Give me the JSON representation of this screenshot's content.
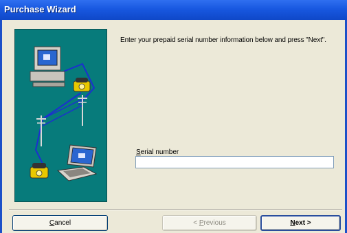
{
  "window": {
    "title": "Purchase Wizard"
  },
  "instruction": "Enter your prepaid serial number information below and press \"Next\".",
  "serial": {
    "label_accel": "S",
    "label_rest": "erial number",
    "value": ""
  },
  "buttons": {
    "cancel": {
      "accel": "C",
      "rest": "ancel"
    },
    "previous": {
      "prefix": "< ",
      "accel": "P",
      "rest": "revious"
    },
    "next": {
      "accel": "N",
      "rest": "ext >"
    }
  },
  "colors": {
    "title_bar": "#1858e0",
    "panel_bg": "#077b7b",
    "window_bg": "#ece9d8",
    "network_cable": "#1c2fd0"
  },
  "illustration": {
    "icons": [
      "desktop-computer-icon",
      "telephone-icon",
      "utility-pole-icon",
      "laptop-icon"
    ]
  }
}
